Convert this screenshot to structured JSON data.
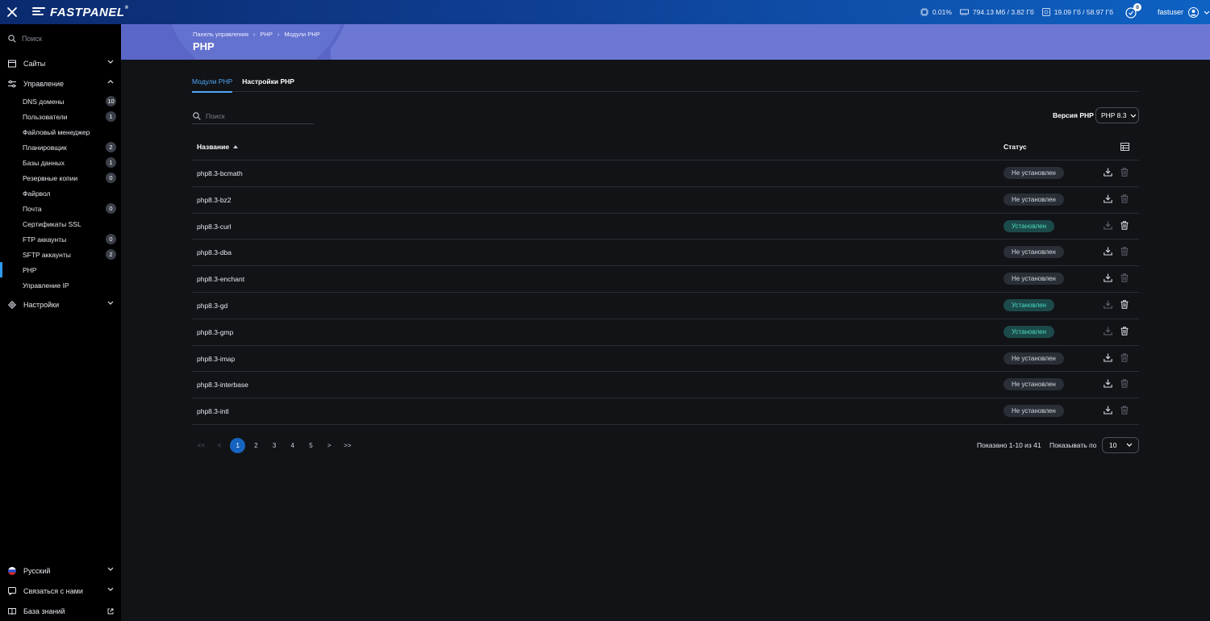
{
  "app": {
    "logo_text": "FASTPANEL",
    "logo_mark": "®"
  },
  "topbar": {
    "cpu": "0.01%",
    "ram": "794.13 Мб / 3.82 Гб",
    "disk": "19.09 Гб / 58.97 Гб",
    "notifications": "0",
    "username": "fastuser"
  },
  "sidebar": {
    "search_placeholder": "Поиск",
    "sites": "Сайты",
    "management": "Управление",
    "items": [
      {
        "label": "DNS домены",
        "badge": "10"
      },
      {
        "label": "Пользователи",
        "badge": "1"
      },
      {
        "label": "Файловый менеджер",
        "badge": ""
      },
      {
        "label": "Планировщик",
        "badge": "2"
      },
      {
        "label": "Базы данных",
        "badge": "1"
      },
      {
        "label": "Резервные копии",
        "badge": "0"
      },
      {
        "label": "Файрвол",
        "badge": ""
      },
      {
        "label": "Почта",
        "badge": "0"
      },
      {
        "label": "Сертификаты SSL",
        "badge": ""
      },
      {
        "label": "FTP аккаунты",
        "badge": "0"
      },
      {
        "label": "SFTP аккаунты",
        "badge": "2"
      },
      {
        "label": "PHP",
        "badge": ""
      },
      {
        "label": "Управление IP",
        "badge": ""
      }
    ],
    "settings": "Настройки",
    "language": "Русский",
    "contact": "Связаться с нами",
    "knowledge": "База знаний"
  },
  "header": {
    "breadcrumb": [
      "Панель управления",
      "PHP",
      "Модули PHP"
    ],
    "breadcrumb_sep": "›",
    "title": "PHP"
  },
  "tabs": {
    "modules": "Модули PHP",
    "settings": "Настройки PHP"
  },
  "filters": {
    "search_placeholder": "Поиск",
    "version_label": "Версия PHP",
    "version_value": "PHP 8.3"
  },
  "table": {
    "col_name": "Название",
    "col_status": "Статус",
    "rows": [
      {
        "name": "php8.3-bcmath",
        "status": "Не установлен"
      },
      {
        "name": "php8.3-bz2",
        "status": "Не установлен"
      },
      {
        "name": "php8.3-curl",
        "status": "Установлен"
      },
      {
        "name": "php8.3-dba",
        "status": "Не установлен"
      },
      {
        "name": "php8.3-enchant",
        "status": "Не установлен"
      },
      {
        "name": "php8.3-gd",
        "status": "Установлен"
      },
      {
        "name": "php8.3-gmp",
        "status": "Установлен"
      },
      {
        "name": "php8.3-imap",
        "status": "Не установлен"
      },
      {
        "name": "php8.3-interbase",
        "status": "Не установлен"
      },
      {
        "name": "php8.3-intl",
        "status": "Не установлен"
      }
    ]
  },
  "pagination": {
    "first": "<<",
    "prev": "<",
    "pages": [
      "1",
      "2",
      "3",
      "4",
      "5"
    ],
    "next": ">",
    "last": ">>",
    "shown": "Показано 1-10 из 41",
    "perpage_label": "Показывать по",
    "perpage_value": "10"
  },
  "colors": {
    "accent": "#4da8f5",
    "installed_text": "#4ad9c0",
    "installed_bg": "#1c4a4a",
    "not_installed_bg": "#2a2e36",
    "page_current": "#1664c0"
  }
}
